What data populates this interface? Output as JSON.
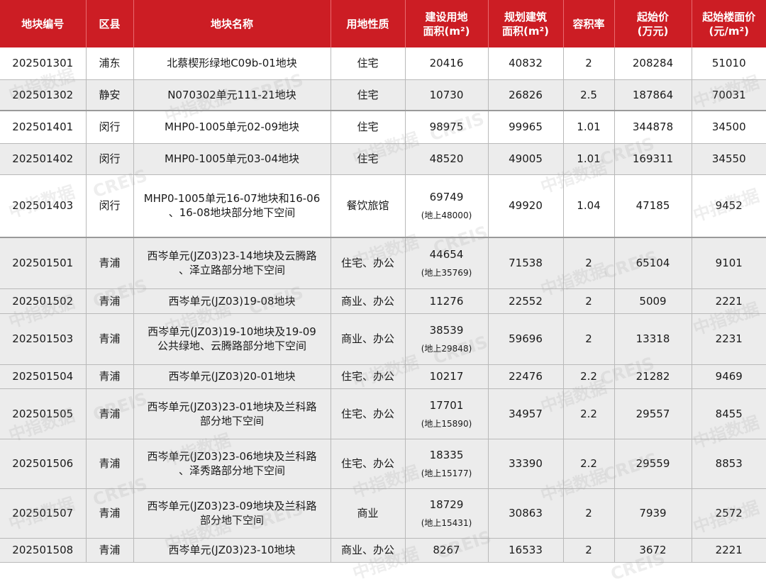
{
  "headers": [
    [
      "地块编号"
    ],
    [
      "区县"
    ],
    [
      "地块名称"
    ],
    [
      "用地性质"
    ],
    [
      "建设用地",
      "面积(m²)"
    ],
    [
      "规划建筑",
      "面积(m²)"
    ],
    [
      "容积率"
    ],
    [
      "起始价",
      "(万元)"
    ],
    [
      "起始楼面价",
      "(元/m²)"
    ]
  ],
  "rows": [
    {
      "id": "202501301",
      "district": "浦东",
      "name": [
        "北蔡楔形绿地C09b-01地块"
      ],
      "use": "住宅",
      "land_area": "20416",
      "land_area_sub": "",
      "build_area": "40832",
      "far": "2",
      "start_price": "208284",
      "floor_price": "51010"
    },
    {
      "id": "202501302",
      "district": "静安",
      "name": [
        "N070302单元111-21地块"
      ],
      "use": "住宅",
      "land_area": "10730",
      "land_area_sub": "",
      "build_area": "26826",
      "far": "2.5",
      "start_price": "187864",
      "floor_price": "70031"
    },
    {
      "id": "202501401",
      "district": "闵行",
      "name": [
        "MHP0-1005单元02-09地块"
      ],
      "use": "住宅",
      "land_area": "98975",
      "land_area_sub": "",
      "build_area": "99965",
      "far": "1.01",
      "start_price": "344878",
      "floor_price": "34500"
    },
    {
      "id": "202501402",
      "district": "闵行",
      "name": [
        "MHP0-1005单元03-04地块"
      ],
      "use": "住宅",
      "land_area": "48520",
      "land_area_sub": "",
      "build_area": "49005",
      "far": "1.01",
      "start_price": "169311",
      "floor_price": "34550"
    },
    {
      "id": "202501403",
      "district": "闵行",
      "name": [
        "MHP0-1005单元16-07地块和16-06",
        "、16-08地块部分地下空间"
      ],
      "use": "餐饮旅馆",
      "land_area": "69749",
      "land_area_sub": "(地上48000)",
      "build_area": "49920",
      "far": "1.04",
      "start_price": "47185",
      "floor_price": "9452"
    },
    {
      "id": "202501501",
      "district": "青浦",
      "name": [
        "西岑单元(JZ03)23-14地块及云腾路",
        "、泽立路部分地下空间"
      ],
      "use": "住宅、办公",
      "land_area": "44654",
      "land_area_sub": "(地上35769)",
      "build_area": "71538",
      "far": "2",
      "start_price": "65104",
      "floor_price": "9101"
    },
    {
      "id": "202501502",
      "district": "青浦",
      "name": [
        "西岑单元(JZ03)19-08地块"
      ],
      "use": "商业、办公",
      "land_area": "11276",
      "land_area_sub": "",
      "build_area": "22552",
      "far": "2",
      "start_price": "5009",
      "floor_price": "2221"
    },
    {
      "id": "202501503",
      "district": "青浦",
      "name": [
        "西岑单元(JZ03)19-10地块及19-09",
        "公共绿地、云腾路部分地下空间"
      ],
      "use": "商业、办公",
      "land_area": "38539",
      "land_area_sub": "(地上29848)",
      "build_area": "59696",
      "far": "2",
      "start_price": "13318",
      "floor_price": "2231"
    },
    {
      "id": "202501504",
      "district": "青浦",
      "name": [
        "西岑单元(JZ03)20-01地块"
      ],
      "use": "住宅、办公",
      "land_area": "10217",
      "land_area_sub": "",
      "build_area": "22476",
      "far": "2.2",
      "start_price": "21282",
      "floor_price": "9469"
    },
    {
      "id": "202501505",
      "district": "青浦",
      "name": [
        "西岑单元(JZ03)23-01地块及兰科路",
        "部分地下空间"
      ],
      "use": "住宅、办公",
      "land_area": "17701",
      "land_area_sub": "(地上15890)",
      "build_area": "34957",
      "far": "2.2",
      "start_price": "29557",
      "floor_price": "8455"
    },
    {
      "id": "202501506",
      "district": "青浦",
      "name": [
        "西岑单元(JZ03)23-06地块及兰科路",
        "、泽秀路部分地下空间"
      ],
      "use": "住宅、办公",
      "land_area": "18335",
      "land_area_sub": "(地上15177)",
      "build_area": "33390",
      "far": "2.2",
      "start_price": "29559",
      "floor_price": "8853"
    },
    {
      "id": "202501507",
      "district": "青浦",
      "name": [
        "西岑单元(JZ03)23-09地块及兰科路",
        "部分地下空间"
      ],
      "use": "商业",
      "land_area": "18729",
      "land_area_sub": "(地上15431)",
      "build_area": "30863",
      "far": "2",
      "start_price": "7939",
      "floor_price": "2572"
    },
    {
      "id": "202501508",
      "district": "青浦",
      "name": [
        "西岑单元(JZ03)23-10地块"
      ],
      "use": "商业、办公",
      "land_area": "8267",
      "land_area_sub": "",
      "build_area": "16533",
      "far": "2",
      "start_price": "3672",
      "floor_price": "2221"
    }
  ],
  "watermark": {
    "cn": "中指数据",
    "en": "CREIS"
  }
}
